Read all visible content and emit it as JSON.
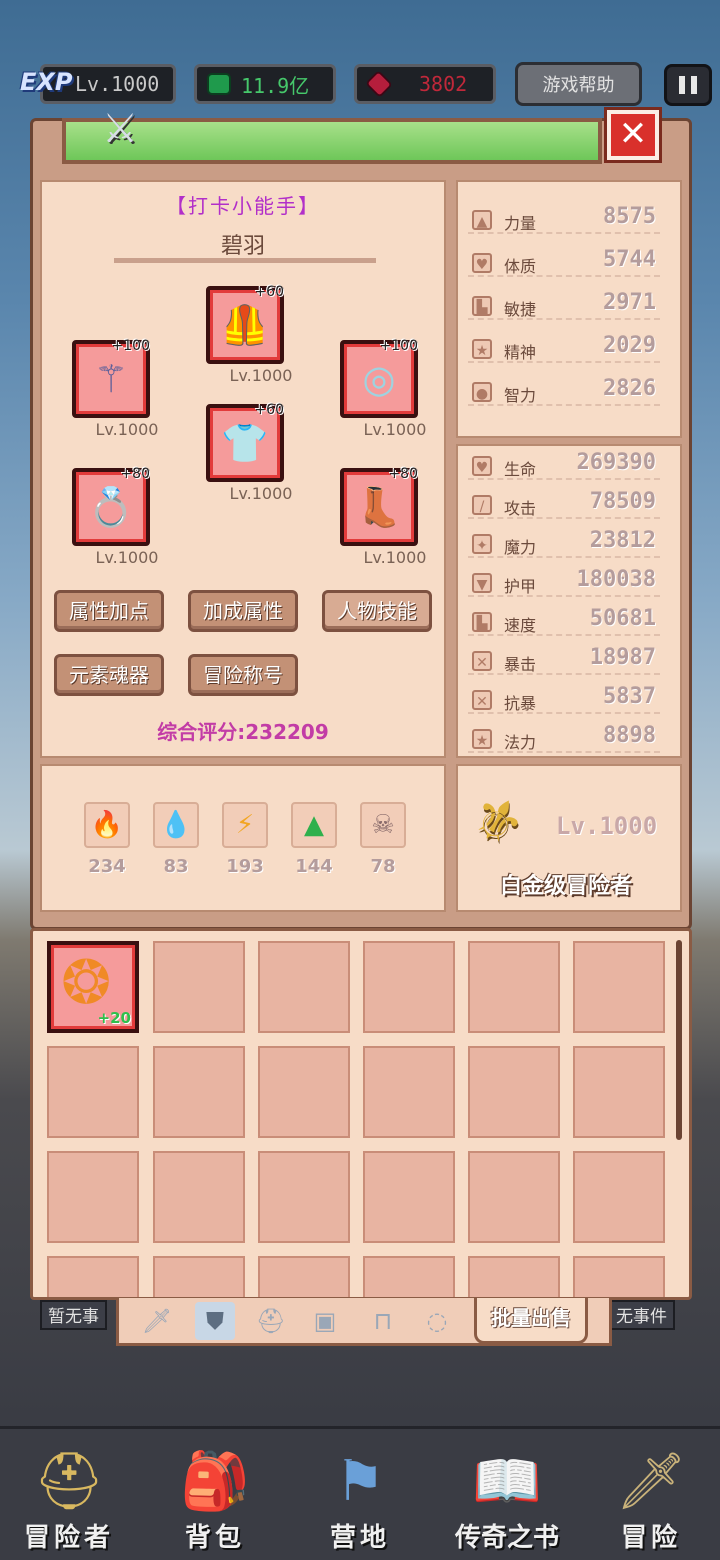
{
  "topbar": {
    "exp_badge": "EXP",
    "level": "Lv.1000",
    "money": "11.9亿",
    "gems": "3802",
    "help_label": "游戏帮助"
  },
  "character": {
    "title_tag": "【打卡小能手】",
    "name": "碧羽",
    "score": "综合评分:232209",
    "rank_level": "Lv.1000",
    "rank_title": "白金级冒险者"
  },
  "equipment": [
    {
      "slot": "helmet",
      "icon": "armor-vest-icon",
      "plus": "+60",
      "level": "Lv.1000"
    },
    {
      "slot": "weapon",
      "icon": "spear-icon",
      "plus": "+100",
      "level": "Lv.1000"
    },
    {
      "slot": "shield",
      "icon": "shield-disc-icon",
      "plus": "+100",
      "level": "Lv.1000"
    },
    {
      "slot": "armor",
      "icon": "chest-armor-icon",
      "plus": "+60",
      "level": "Lv.1000"
    },
    {
      "slot": "ring",
      "icon": "ring-icon",
      "plus": "+80",
      "level": "Lv.1000"
    },
    {
      "slot": "boots",
      "icon": "boots-icon",
      "plus": "+80",
      "level": "Lv.1000"
    }
  ],
  "actions": {
    "attr_points": "属性加点",
    "bonus_attr": "加成属性",
    "char_skills": "人物技能",
    "element_soul": "元素魂器",
    "adventure_title": "冒险称号"
  },
  "base_stats": [
    {
      "name": "力量",
      "value": "8575"
    },
    {
      "name": "体质",
      "value": "5744"
    },
    {
      "name": "敏捷",
      "value": "2971"
    },
    {
      "name": "精神",
      "value": "2029"
    },
    {
      "name": "智力",
      "value": "2826"
    }
  ],
  "combat_stats": [
    {
      "name": "生命",
      "value": "269390"
    },
    {
      "name": "攻击",
      "value": "78509"
    },
    {
      "name": "魔力",
      "value": "23812"
    },
    {
      "name": "护甲",
      "value": "180038"
    },
    {
      "name": "速度",
      "value": "50681"
    },
    {
      "name": "暴击",
      "value": "18987"
    },
    {
      "name": "抗暴",
      "value": "5837"
    },
    {
      "name": "法力",
      "value": "8898"
    }
  ],
  "elements": [
    {
      "icon": "fire-icon",
      "value": "234"
    },
    {
      "icon": "water-icon",
      "value": "83"
    },
    {
      "icon": "lightning-icon",
      "value": "193"
    },
    {
      "icon": "earth-icon",
      "value": "144"
    },
    {
      "icon": "skull-icon",
      "value": "78"
    }
  ],
  "inventory": {
    "first_item_plus": "+20",
    "sell_label": "批量出售",
    "left_status": "暂无事",
    "right_status": "无事件"
  },
  "nav": [
    {
      "label": "冒险者",
      "icon": "helmet-icon"
    },
    {
      "label": "背包",
      "icon": "backpack-icon"
    },
    {
      "label": "营地",
      "icon": "banner-icon"
    },
    {
      "label": "传奇之书",
      "icon": "book-icon"
    },
    {
      "label": "冒险",
      "icon": "sword-icon"
    }
  ],
  "colors": {
    "panel": "#c99d86",
    "panel_light": "#f7dcc7",
    "slot_red": "#e23b3b",
    "title_purple": "#b22fc9",
    "score_pink": "#c23ca6"
  }
}
